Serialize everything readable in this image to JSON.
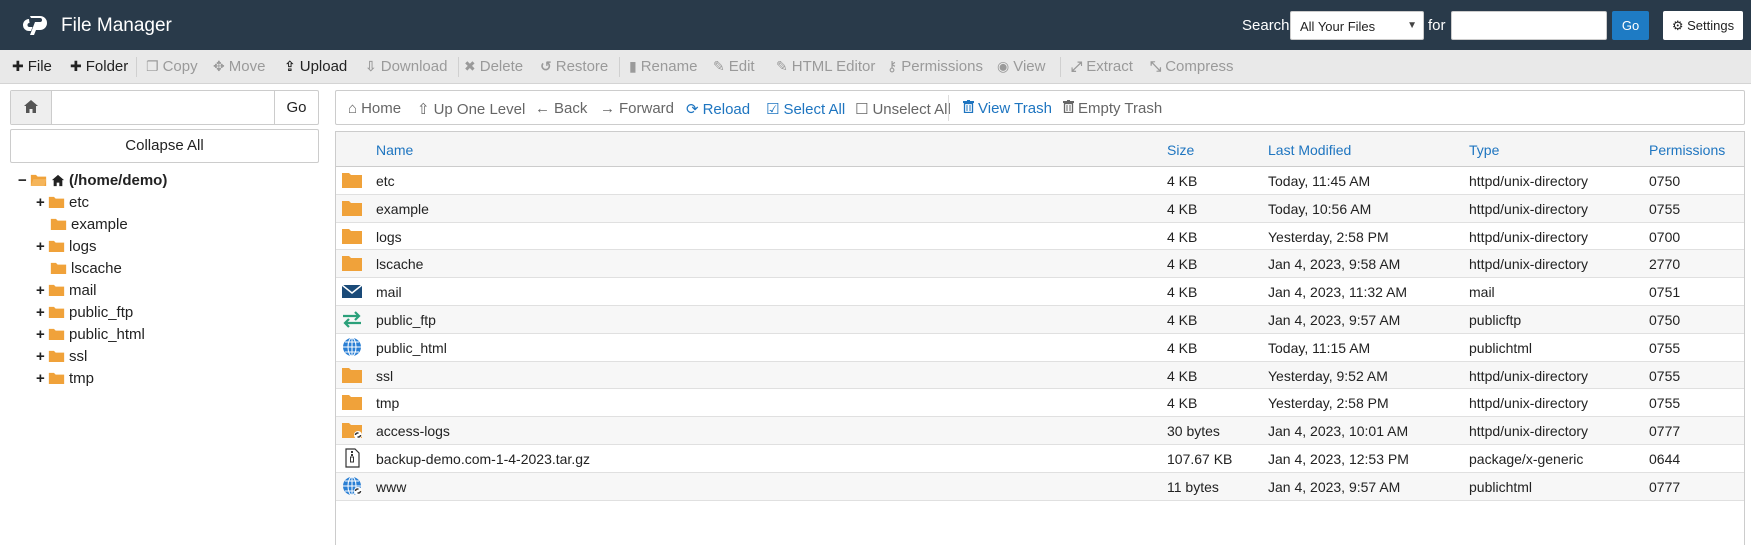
{
  "header": {
    "app_title": "File Manager",
    "search_label": "Search",
    "search_scope": "All Your Files",
    "for_label": "for",
    "search_value": "",
    "go_label": "Go",
    "settings_label": "Settings"
  },
  "toolbar": [
    {
      "label": "File",
      "icon": "plus-icon",
      "enabled": true
    },
    {
      "label": "Folder",
      "icon": "plus-icon",
      "enabled": true
    },
    {
      "label": "Copy",
      "icon": "copy-icon",
      "enabled": false
    },
    {
      "label": "Move",
      "icon": "move-icon",
      "enabled": false
    },
    {
      "label": "Upload",
      "icon": "upload-icon",
      "enabled": true
    },
    {
      "label": "Download",
      "icon": "download-icon",
      "enabled": false
    },
    {
      "label": "Delete",
      "icon": "delete-icon",
      "enabled": false
    },
    {
      "label": "Restore",
      "icon": "restore-icon",
      "enabled": false
    },
    {
      "label": "Rename",
      "icon": "file-icon",
      "enabled": false
    },
    {
      "label": "Edit",
      "icon": "pencil-icon",
      "enabled": false
    },
    {
      "label": "HTML Editor",
      "icon": "edit-box-icon",
      "enabled": false
    },
    {
      "label": "Permissions",
      "icon": "key-icon",
      "enabled": false
    },
    {
      "label": "View",
      "icon": "eye-icon",
      "enabled": false
    },
    {
      "label": "Extract",
      "icon": "expand-icon",
      "enabled": false
    },
    {
      "label": "Compress",
      "icon": "compress-icon",
      "enabled": false
    }
  ],
  "left": {
    "path_value": "",
    "go_label": "Go",
    "collapse_label": "Collapse All",
    "tree": [
      {
        "label": "(/home/demo)",
        "toggle": "−",
        "root": true
      },
      {
        "label": "etc",
        "toggle": "+"
      },
      {
        "label": "example",
        "toggle": ""
      },
      {
        "label": "logs",
        "toggle": "+"
      },
      {
        "label": "lscache",
        "toggle": ""
      },
      {
        "label": "mail",
        "toggle": "+"
      },
      {
        "label": "public_ftp",
        "toggle": "+"
      },
      {
        "label": "public_html",
        "toggle": "+"
      },
      {
        "label": "ssl",
        "toggle": "+"
      },
      {
        "label": "tmp",
        "toggle": "+"
      }
    ]
  },
  "nav": [
    {
      "label": "Home",
      "icon": "home-icon",
      "blue": false
    },
    {
      "label": "Up One Level",
      "icon": "up-arrow-icon",
      "blue": false
    },
    {
      "label": "Back",
      "icon": "back-arrow-icon",
      "blue": false
    },
    {
      "label": "Forward",
      "icon": "forward-arrow-icon",
      "blue": false
    },
    {
      "label": "Reload",
      "icon": "reload-icon",
      "blue": true
    },
    {
      "label": "Select All",
      "icon": "checked-box-icon",
      "blue": true
    },
    {
      "label": "Unselect All",
      "icon": "empty-box-icon",
      "blue": false
    },
    {
      "label": "View Trash",
      "icon": "trash-icon",
      "blue": true
    },
    {
      "label": "Empty Trash",
      "icon": "trash-icon",
      "blue": false
    }
  ],
  "table": {
    "columns": [
      "Name",
      "Size",
      "Last Modified",
      "Type",
      "Permissions"
    ],
    "rows": [
      {
        "name": "etc",
        "size": "4 KB",
        "modified": "Today, 11:45 AM",
        "type": "httpd/unix-directory",
        "perms": "0750",
        "icon": "folder"
      },
      {
        "name": "example",
        "size": "4 KB",
        "modified": "Today, 10:56 AM",
        "type": "httpd/unix-directory",
        "perms": "0755",
        "icon": "folder"
      },
      {
        "name": "logs",
        "size": "4 KB",
        "modified": "Yesterday, 2:58 PM",
        "type": "httpd/unix-directory",
        "perms": "0700",
        "icon": "folder"
      },
      {
        "name": "lscache",
        "size": "4 KB",
        "modified": "Jan 4, 2023, 9:58 AM",
        "type": "httpd/unix-directory",
        "perms": "2770",
        "icon": "folder"
      },
      {
        "name": "mail",
        "size": "4 KB",
        "modified": "Jan 4, 2023, 11:32 AM",
        "type": "mail",
        "perms": "0751",
        "icon": "mail"
      },
      {
        "name": "public_ftp",
        "size": "4 KB",
        "modified": "Jan 4, 2023, 9:57 AM",
        "type": "publicftp",
        "perms": "0750",
        "icon": "ftp"
      },
      {
        "name": "public_html",
        "size": "4 KB",
        "modified": "Today, 11:15 AM",
        "type": "publichtml",
        "perms": "0755",
        "icon": "globe"
      },
      {
        "name": "ssl",
        "size": "4 KB",
        "modified": "Yesterday, 9:52 AM",
        "type": "httpd/unix-directory",
        "perms": "0755",
        "icon": "folder"
      },
      {
        "name": "tmp",
        "size": "4 KB",
        "modified": "Yesterday, 2:58 PM",
        "type": "httpd/unix-directory",
        "perms": "0755",
        "icon": "folder"
      },
      {
        "name": "access-logs",
        "size": "30 bytes",
        "modified": "Jan 4, 2023, 10:01 AM",
        "type": "httpd/unix-directory",
        "perms": "0777",
        "icon": "folder-link"
      },
      {
        "name": "backup-demo.com-1-4-2023.tar.gz",
        "size": "107.67 KB",
        "modified": "Jan 4, 2023, 12:53 PM",
        "type": "package/x-generic",
        "perms": "0644",
        "icon": "archive"
      },
      {
        "name": "www",
        "size": "11 bytes",
        "modified": "Jan 4, 2023, 9:57 AM",
        "type": "publichtml",
        "perms": "0777",
        "icon": "globe-link"
      }
    ]
  },
  "colors": {
    "header_bg": "#293a4a",
    "accent": "#1e75c0",
    "folder": "#f0a23a"
  }
}
